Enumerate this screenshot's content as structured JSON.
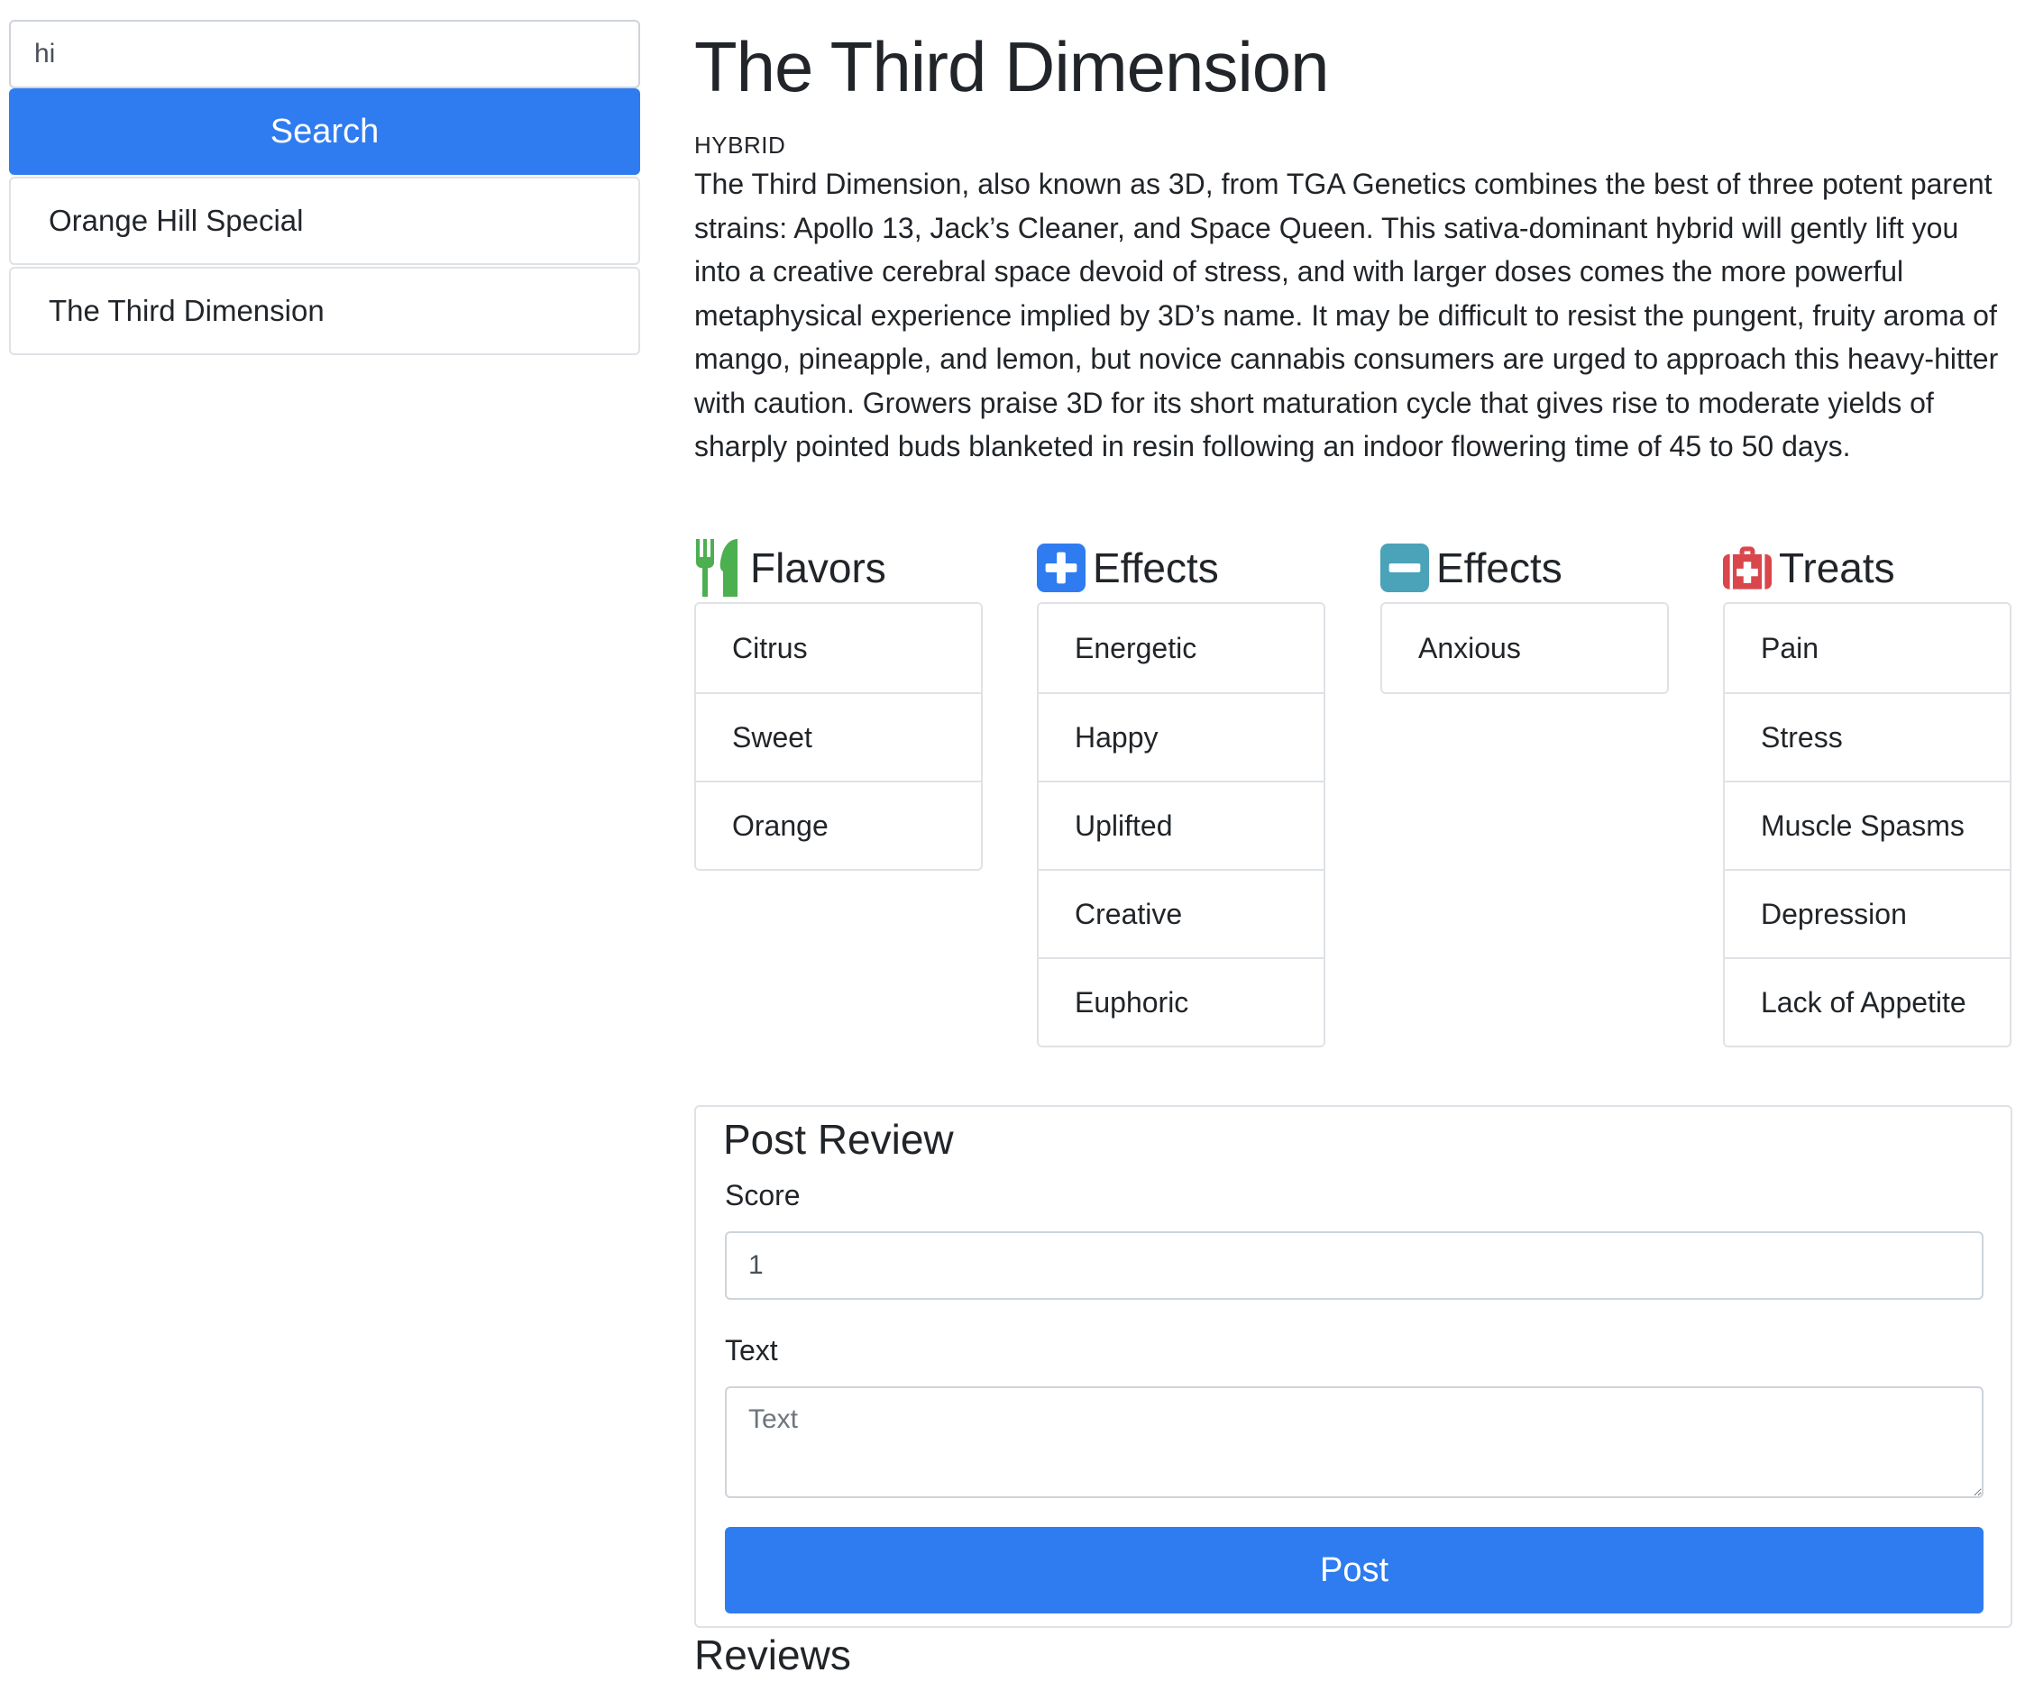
{
  "search": {
    "value": "hi",
    "button_label": "Search"
  },
  "results": [
    {
      "label": "Orange Hill Special"
    },
    {
      "label": "The Third Dimension"
    }
  ],
  "strain": {
    "name": "The Third Dimension",
    "type": "HYBRID",
    "description": "The Third Dimension, also known as 3D, from TGA Genetics combines the best of three potent parent strains: Apollo 13, Jack’s Cleaner, and Space Queen. This sativa-dominant hybrid will gently lift you into a creative cerebral space devoid of stress, and with larger doses comes the more powerful metaphysical experience implied by 3D’s name. It may be difficult to resist the pungent, fruity aroma of mango, pineapple, and lemon, but novice cannabis consumers are urged to approach this heavy-hitter with caution. Growers praise 3D for its short maturation cycle that gives rise to moderate yields of sharply pointed buds blanketed in resin following an indoor flowering time of 45 to 50 days."
  },
  "flavors": {
    "title": "Flavors",
    "icon": "utensils-icon",
    "icon_color": "#4caf50",
    "items": [
      "Citrus",
      "Sweet",
      "Orange"
    ]
  },
  "positive_effects": {
    "title": "Effects",
    "icon": "plus-square-icon",
    "icon_color": "#2f7cf0",
    "items": [
      "Energetic",
      "Happy",
      "Uplifted",
      "Creative",
      "Euphoric"
    ]
  },
  "negative_effects": {
    "title": "Effects",
    "icon": "minus-square-icon",
    "icon_color": "#4aa3b8",
    "items": [
      "Anxious"
    ]
  },
  "treats": {
    "title": "Treats",
    "icon": "medkit-icon",
    "icon_color": "#d9464b",
    "items": [
      "Pain",
      "Stress",
      "Muscle Spasms",
      "Depression",
      "Lack of Appetite"
    ]
  },
  "post_review": {
    "title": "Post Review",
    "score_label": "Score",
    "score_value": "1",
    "text_label": "Text",
    "text_placeholder": "Text",
    "post_label": "Post"
  },
  "reviews": {
    "title": "Reviews"
  }
}
